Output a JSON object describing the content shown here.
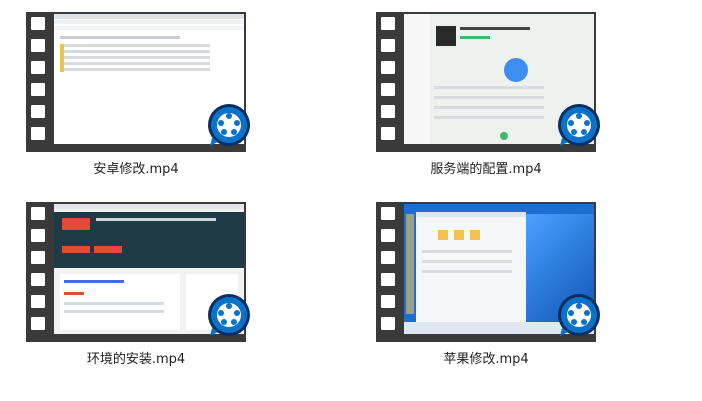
{
  "files": [
    {
      "name": "安卓修改.mp4",
      "kind": "video",
      "thumb": "file-manager",
      "icon": "quicktime-icon"
    },
    {
      "name": "服务端的配置.mp4",
      "kind": "video",
      "thumb": "music-app",
      "icon": "quicktime-icon"
    },
    {
      "name": "环境的安装.mp4",
      "kind": "video",
      "thumb": "web-page",
      "icon": "quicktime-icon"
    },
    {
      "name": "苹果修改.mp4",
      "kind": "video",
      "thumb": "windows-desktop",
      "icon": "quicktime-icon"
    }
  ],
  "colors": {
    "film": "#3a3a3a",
    "badge": "#0a73c9",
    "badge_dark": "#0b2f63"
  }
}
